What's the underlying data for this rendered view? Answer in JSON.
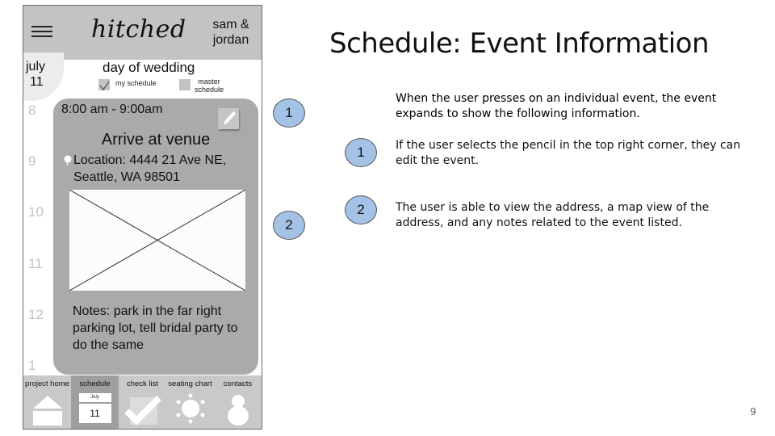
{
  "slide": {
    "title": "Schedule: Event Information",
    "page_number": "9",
    "intro": "When the user presses on an individual event, the event expands to show the following information.",
    "notes": [
      {
        "number": "1",
        "text": "If the user selects the pencil in the top right corner, they can edit the event."
      },
      {
        "number": "2",
        "text": "The user is able to view the address, a map view of the address, and any notes related to the event listed."
      }
    ],
    "phone_callouts": [
      "1",
      "2"
    ],
    "callout_color": "#a4c2e6"
  },
  "app": {
    "logo": "hitched",
    "couple_line1": "sam &",
    "couple_line2": "jordan",
    "date": {
      "month": "july",
      "day": "11"
    },
    "schedule_title": "day of wedding",
    "filters": {
      "my_schedule": {
        "label": "my schedule",
        "checked": true
      },
      "master_schedule": {
        "label_line1": "master",
        "label_line2": "schedule",
        "checked": false
      }
    },
    "hours": [
      "8",
      "9",
      "10",
      "11",
      "12",
      "1"
    ],
    "event": {
      "time": "8:00 am - 9:00am",
      "title": "Arrive at venue",
      "location_line1": "Location: 4444 21 Ave NE,",
      "location_line2": "Seattle, WA 98501",
      "notes": "Notes: park in the far right parking lot, tell bridal party to do the same"
    },
    "tabs": [
      {
        "label": "project home",
        "icon": "home-icon",
        "active": false
      },
      {
        "label": "schedule",
        "icon": "calendar-icon",
        "active": true,
        "icon_month": "July",
        "icon_day": "11"
      },
      {
        "label": "check list",
        "icon": "checkmark-icon",
        "active": false
      },
      {
        "label": "seating chart",
        "icon": "seating-icon",
        "active": false
      },
      {
        "label": "contacts",
        "icon": "person-icon",
        "active": false
      }
    ]
  }
}
